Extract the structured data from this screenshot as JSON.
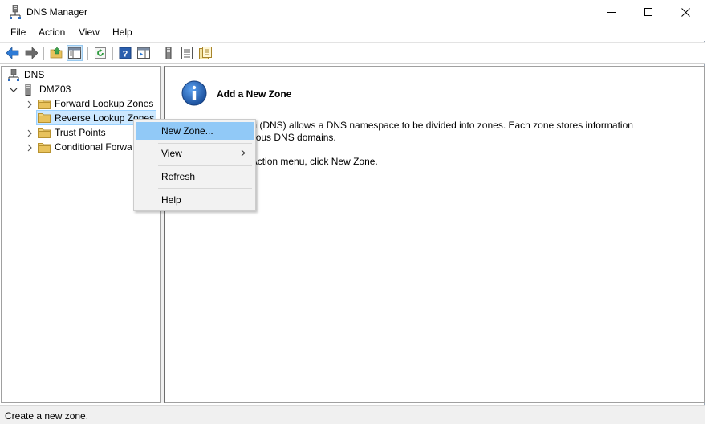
{
  "window": {
    "title": "DNS Manager",
    "icon": "dns-server-icon"
  },
  "menu": {
    "file": "File",
    "action": "Action",
    "view": "View",
    "help": "Help"
  },
  "toolbar": {
    "buttons": [
      "back-arrow-icon",
      "forward-arrow-icon",
      "up-folder-icon",
      "show-hide-console-tree-icon",
      "refresh-icon",
      "help-icon",
      "action-pane-icon",
      "server-icon",
      "list-icon",
      "properties-icon"
    ]
  },
  "tree": {
    "root": "DNS",
    "server": "DMZ03",
    "items": [
      {
        "label": "Forward Lookup Zones"
      },
      {
        "label": "Reverse Lookup Zones"
      },
      {
        "label": "Trust Points"
      },
      {
        "label": "Conditional Forwa"
      }
    ]
  },
  "content": {
    "title": "Add a New Zone",
    "line1": "e System (DNS) allows a DNS namespace to be divided into zones. Each zone stores information",
    "line2": "e contiguous DNS domains.",
    "line3": ", on the Action menu, click New Zone."
  },
  "context_menu": {
    "items": [
      {
        "label": "New Zone..."
      },
      {
        "label": "View"
      },
      {
        "label": "Refresh"
      },
      {
        "label": "Help"
      }
    ]
  },
  "status": {
    "text": "Create a new zone."
  },
  "colors": {
    "selection": "#cce8ff",
    "menu_highlight": "#91c9f7",
    "folder": "#e8c25c",
    "info_icon": "#1f62b5"
  }
}
